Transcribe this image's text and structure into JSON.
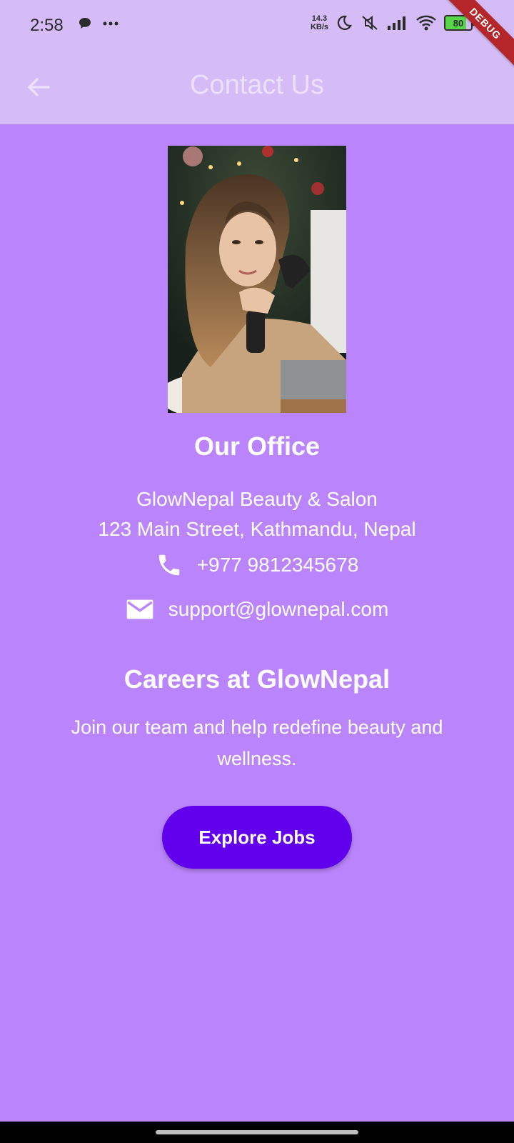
{
  "status_bar": {
    "time": "2:58",
    "net_speed_value": "14.3",
    "net_speed_unit": "KB/s",
    "battery": "80",
    "icons": [
      "chat-bubble-icon",
      "more-dots-icon",
      "moon-icon",
      "mute-icon",
      "signal-icon",
      "wifi-icon",
      "battery-icon"
    ]
  },
  "debug_banner": "DEBUG",
  "app_bar": {
    "title": "Contact Us",
    "back_icon": "arrow-back-icon"
  },
  "office": {
    "title": "Our Office",
    "address_line1": "GlowNepal Beauty & Salon",
    "address_line2": "123 Main Street, Kathmandu, Nepal",
    "phone": "+977 9812345678",
    "email": "support@glownepal.com"
  },
  "careers": {
    "title": "Careers at GlowNepal",
    "text": "Join our team and help redefine beauty and wellness.",
    "button_label": "Explore Jobs"
  },
  "colors": {
    "background": "#BA85FC",
    "app_bar": "#D6BCF7",
    "button": "#6200EE",
    "debug_ribbon": "#B5262B"
  }
}
